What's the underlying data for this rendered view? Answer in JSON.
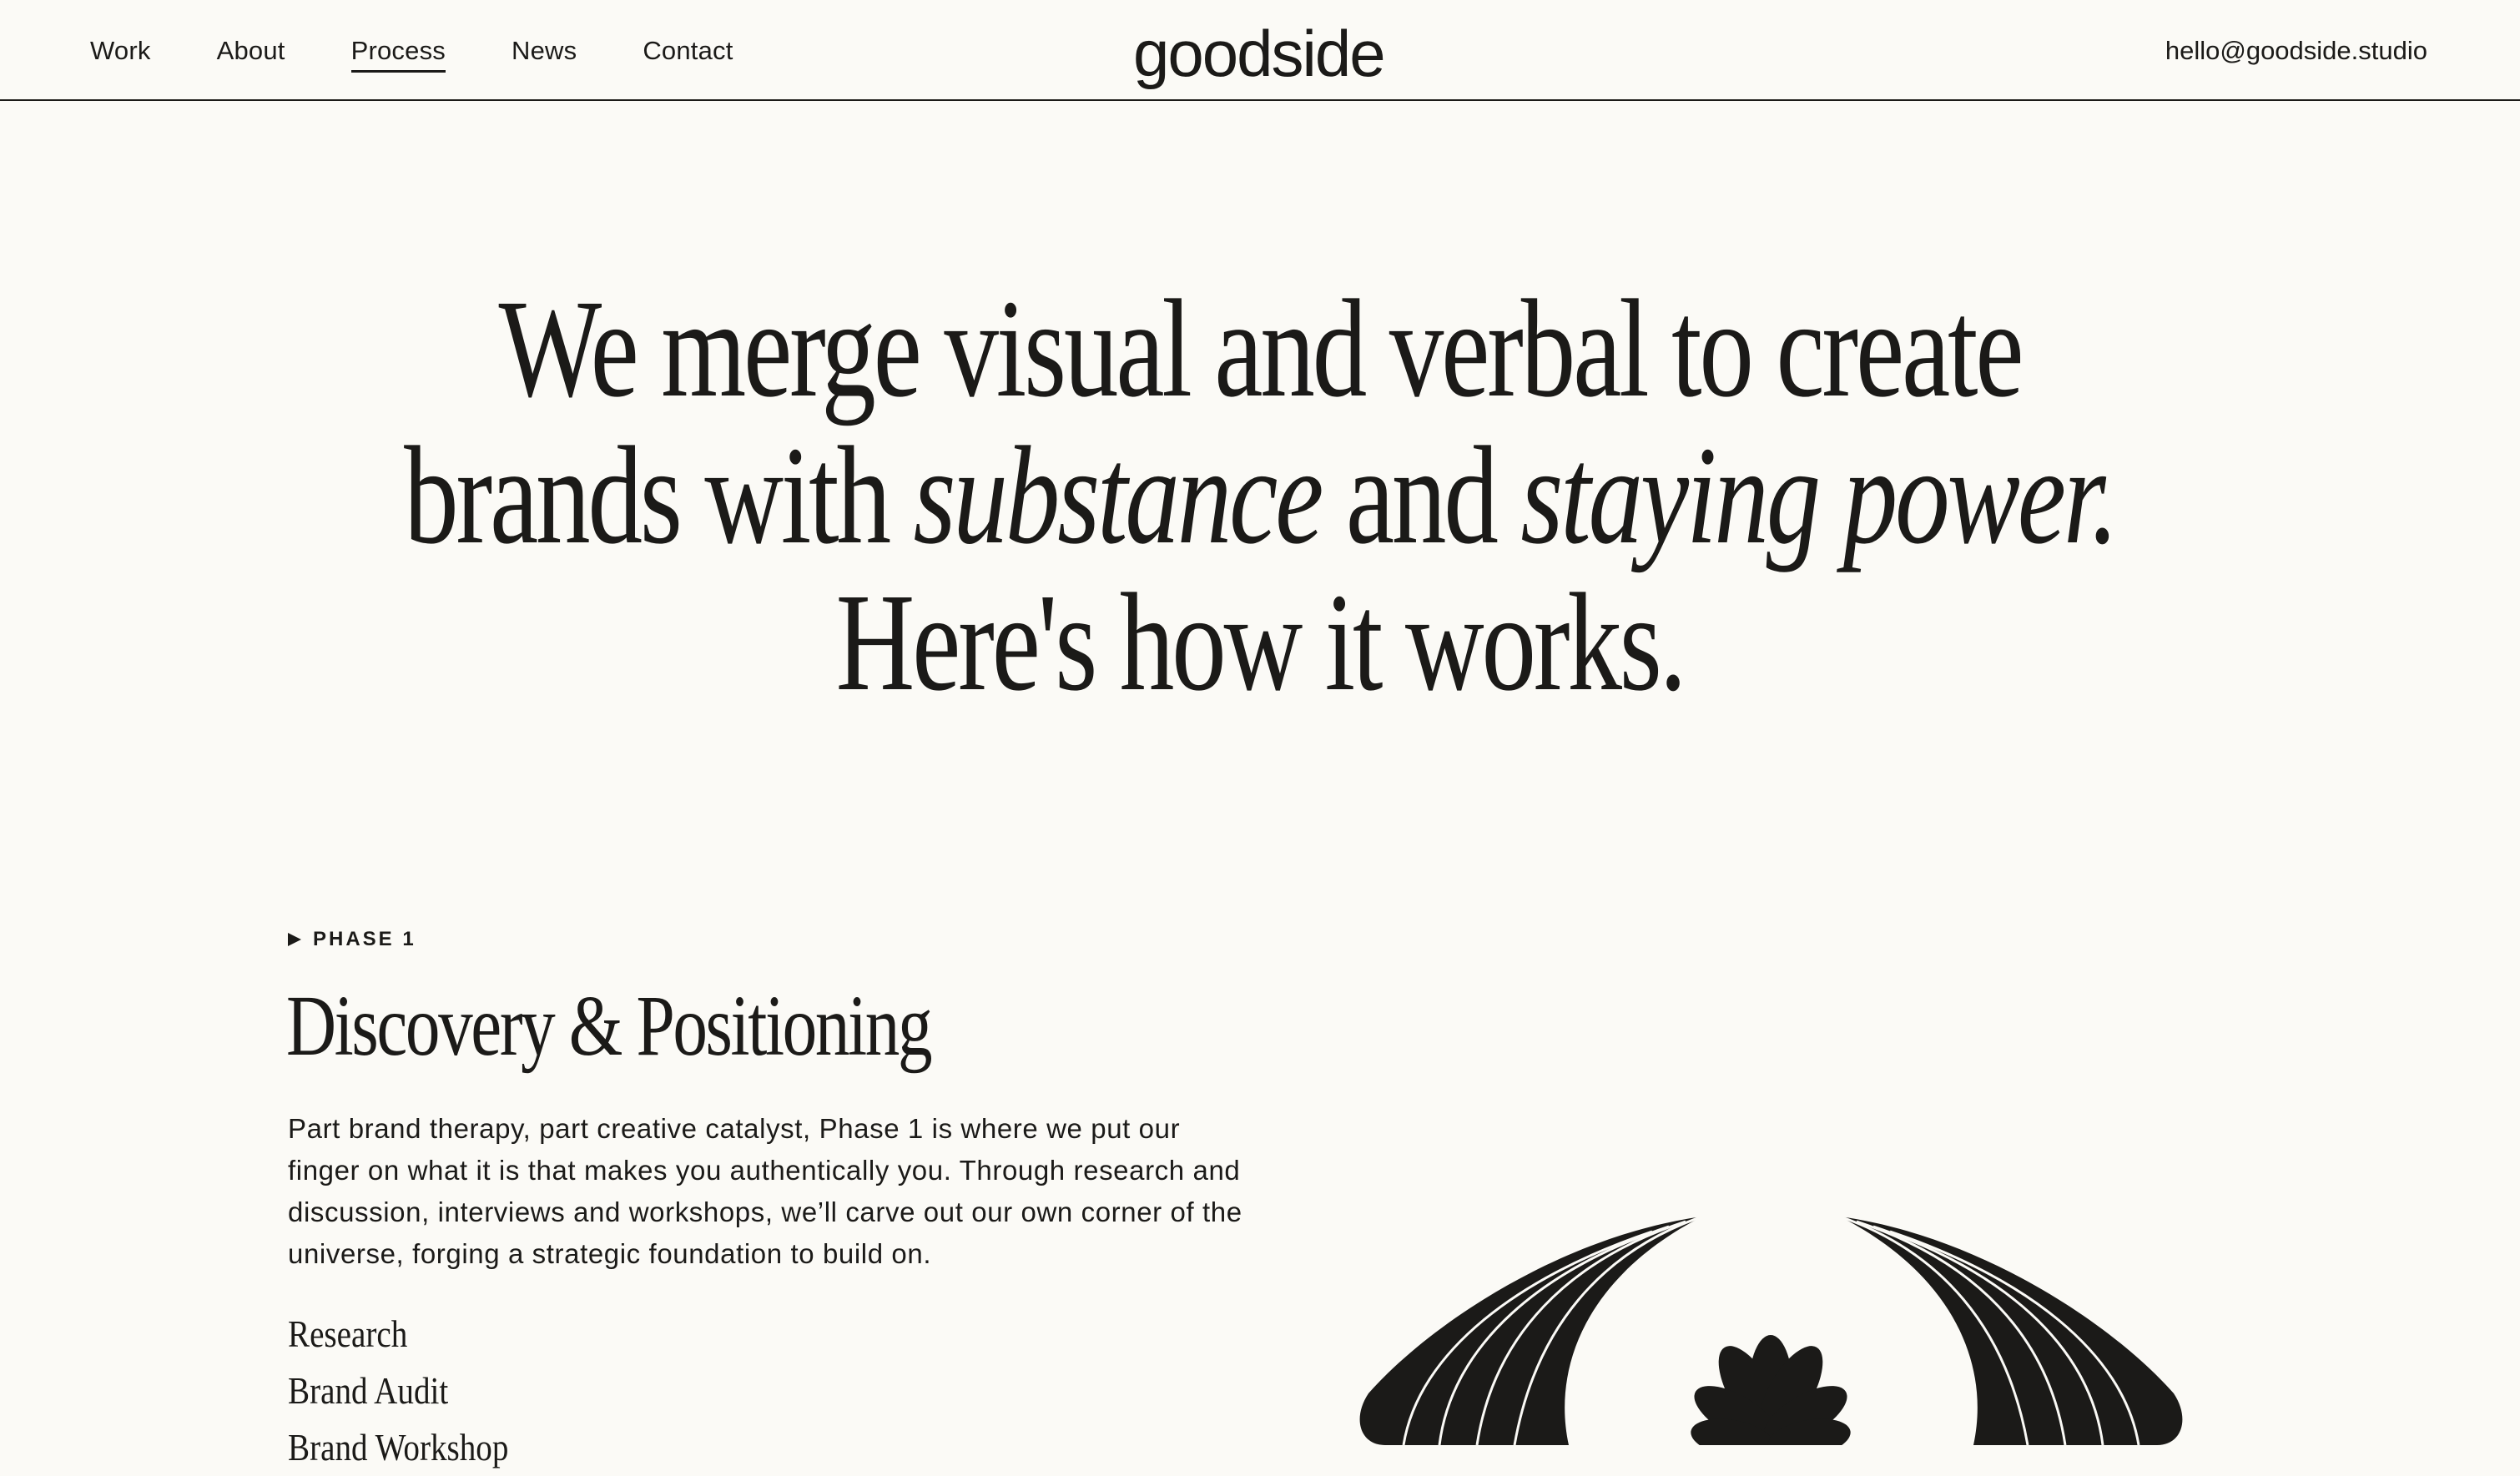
{
  "nav": {
    "items": [
      {
        "label": "Work"
      },
      {
        "label": "About"
      },
      {
        "label": "Process",
        "active": true
      },
      {
        "label": "News"
      },
      {
        "label": "Contact"
      }
    ]
  },
  "brand": {
    "name": "goodside"
  },
  "contact": {
    "email": "hello@goodside.studio"
  },
  "hero": {
    "line1": "We merge visual and verbal to create",
    "line2_a": "brands with ",
    "line2_em1": "substance",
    "line2_b": " and ",
    "line2_em2": "staying power.",
    "line3": "Here's how it works."
  },
  "phase": {
    "label": "PHASE 1",
    "title": "Discovery & Positioning",
    "description": "Part brand therapy, part creative catalyst, Phase 1 is where we put our finger on what it is that makes you authentically you. Through research and discussion, interviews and workshops, we’ll carve out our own corner of the universe, forging a strategic foundation to build on.",
    "services": [
      "Research",
      "Brand Audit",
      "Brand Workshop"
    ]
  },
  "colors": {
    "background": "#fbfaf6",
    "ink": "#1b1a18"
  },
  "icons": {
    "phase_marker": "play-triangle-icon",
    "illustration": "shell-flower-illustration"
  }
}
